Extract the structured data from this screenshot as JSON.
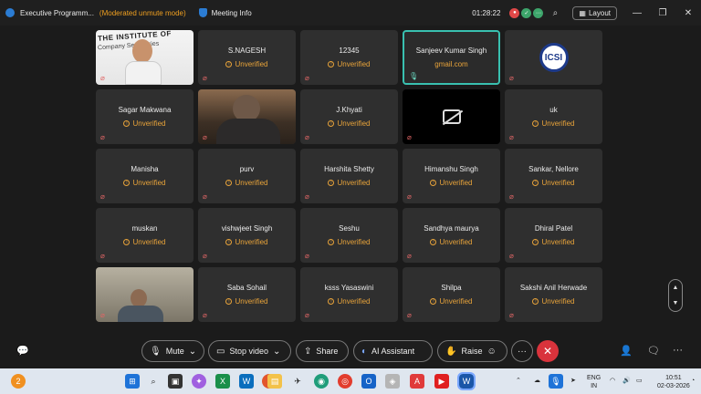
{
  "window": {
    "app_title": "Executive Programm...",
    "mode": "(Moderated unmute mode)",
    "meeting_info": "Meeting Info",
    "timer": "01:28:22",
    "layout_label": "Layout"
  },
  "participants": [
    {
      "name": "",
      "sub": "",
      "kind": "video-banner",
      "mic": "off"
    },
    {
      "name": "S.NAGESH",
      "sub": "Unverified",
      "kind": "name",
      "mic": "off"
    },
    {
      "name": "12345",
      "sub": "Unverified",
      "kind": "name",
      "mic": "off"
    },
    {
      "name": "Sanjeev Kumar Singh",
      "sub": "gmail.com",
      "kind": "active",
      "mic": "on"
    },
    {
      "name": "",
      "sub": "",
      "kind": "logo",
      "mic": "off"
    },
    {
      "name": "Sagar Makwana",
      "sub": "Unverified",
      "kind": "name",
      "mic": "off"
    },
    {
      "name": "",
      "sub": "",
      "kind": "video-oldman",
      "mic": "off"
    },
    {
      "name": "J.Khyati",
      "sub": "Unverified",
      "kind": "name",
      "mic": "off"
    },
    {
      "name": "",
      "sub": "",
      "kind": "camera-off",
      "mic": "off"
    },
    {
      "name": "uk",
      "sub": "Unverified",
      "kind": "name",
      "mic": "off"
    },
    {
      "name": "Manisha",
      "sub": "Unverified",
      "kind": "name",
      "mic": "off"
    },
    {
      "name": "purv",
      "sub": "Unverified",
      "kind": "name",
      "mic": "off"
    },
    {
      "name": "Harshita Shetty",
      "sub": "Unverified",
      "kind": "name",
      "mic": "off"
    },
    {
      "name": "Himanshu Singh",
      "sub": "Unverified",
      "kind": "name",
      "mic": "off"
    },
    {
      "name": "Sankar, Nellore",
      "sub": "Unverified",
      "kind": "name",
      "mic": "off"
    },
    {
      "name": "muskan",
      "sub": "Unverified",
      "kind": "name",
      "mic": "off"
    },
    {
      "name": "vishwjeet Singh",
      "sub": "Unverified",
      "kind": "name",
      "mic": "off"
    },
    {
      "name": "Seshu",
      "sub": "Unverified",
      "kind": "name",
      "mic": "off"
    },
    {
      "name": "Sandhya maurya",
      "sub": "Unverified",
      "kind": "name",
      "mic": "off"
    },
    {
      "name": "Dhiral Patel",
      "sub": "Unverified",
      "kind": "name",
      "mic": "off"
    },
    {
      "name": "",
      "sub": "",
      "kind": "video-man2",
      "mic": "off"
    },
    {
      "name": "Saba Sohail",
      "sub": "Unverified",
      "kind": "name",
      "mic": "off"
    },
    {
      "name": "ksss Yasaswini",
      "sub": "Unverified",
      "kind": "name",
      "mic": "off"
    },
    {
      "name": "Shilpa",
      "sub": "Unverified",
      "kind": "name",
      "mic": "off"
    },
    {
      "name": "Sakshi Anil Herwade",
      "sub": "Unverified",
      "kind": "name",
      "mic": "off"
    }
  ],
  "banner": {
    "line1": "THE INSTITUTE OF",
    "line2": "Company Secretaries"
  },
  "org_logo_text": "ICSI",
  "toolbar": {
    "mute": "Mute",
    "stop_video": "Stop video",
    "share": "Share",
    "ai_assistant": "AI Assistant",
    "raise": "Raise",
    "more": "···",
    "end": "✕"
  },
  "taskbar": {
    "lang_top": "ENG",
    "lang_bottom": "IN",
    "time": "10:51",
    "date": "02-03-2026",
    "notif_count": "2"
  },
  "colors": {
    "accent": "#39c0b0",
    "unverified": "#e8a33a",
    "end_call": "#d9333c",
    "mode": "#f0a020"
  }
}
